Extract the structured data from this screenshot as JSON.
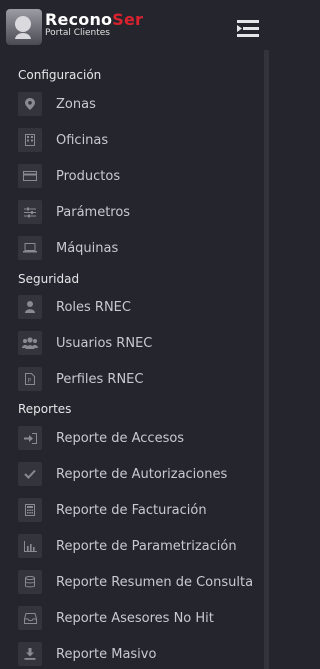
{
  "header": {
    "brand_part1": "Recono",
    "brand_part2": "Ser",
    "brand_subtitle": "Portal Clientes",
    "logo_icon": "head-profile-icon",
    "toggle_icon": "menu-collapse-icon"
  },
  "sections": [
    {
      "title": "Configuración"
    },
    {
      "title": "Seguridad"
    },
    {
      "title": "Reportes"
    }
  ],
  "items": [
    {
      "label": "Zonas",
      "icon": "map-marker-icon"
    },
    {
      "label": "Oficinas",
      "icon": "building-icon"
    },
    {
      "label": "Productos",
      "icon": "credit-card-icon"
    },
    {
      "label": "Parámetros",
      "icon": "sliders-icon"
    },
    {
      "label": "Máquinas",
      "icon": "laptop-icon"
    },
    {
      "label": "Roles RNEC",
      "icon": "user-icon"
    },
    {
      "label": "Usuarios RNEC",
      "icon": "users-icon"
    },
    {
      "label": "Perfiles RNEC",
      "icon": "file-icon"
    },
    {
      "label": "Reporte de Accesos",
      "icon": "sign-in-icon"
    },
    {
      "label": "Reporte de Autorizaciones",
      "icon": "check-icon"
    },
    {
      "label": "Reporte de Facturación",
      "icon": "calculator-icon"
    },
    {
      "label": "Reporte de Parametrización",
      "icon": "bar-chart-icon"
    },
    {
      "label": "Reporte Resumen de Consulta",
      "icon": "database-icon"
    },
    {
      "label": "Reporte Asesores No Hit",
      "icon": "inbox-icon"
    },
    {
      "label": "Reporte Masivo",
      "icon": "download-icon"
    }
  ]
}
